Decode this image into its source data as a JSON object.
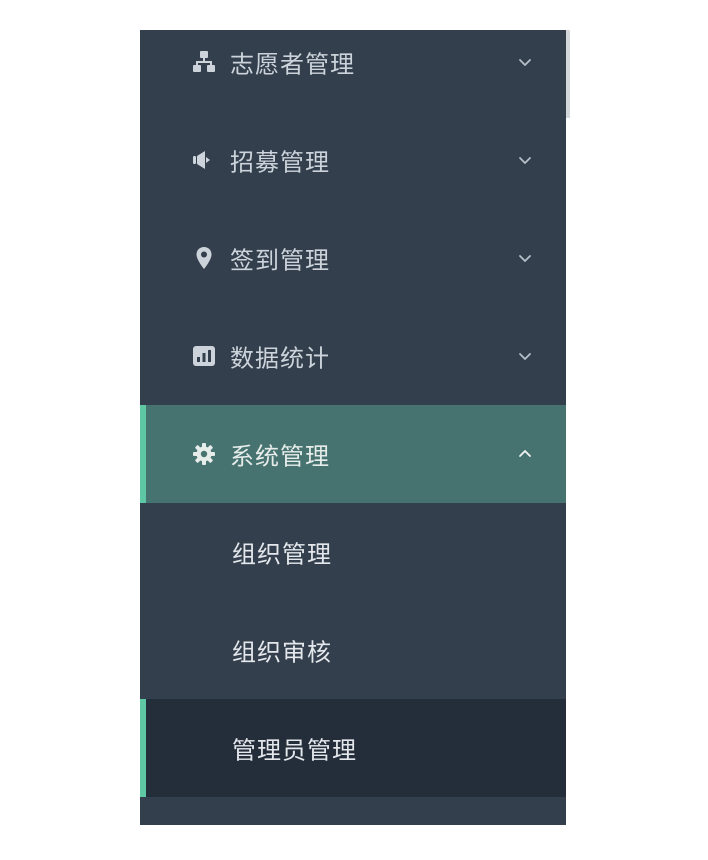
{
  "colors": {
    "sidebar_bg": "#333f4d",
    "expanded_bg": "#46726f",
    "active_sub_bg": "#242d3a",
    "accent": "#5ec7a4",
    "text": "#ccd3da"
  },
  "menu": {
    "items": [
      {
        "label": "志愿者管理",
        "icon": "sitemap-icon",
        "state": "collapsed"
      },
      {
        "label": "招募管理",
        "icon": "bullhorn-icon",
        "state": "collapsed"
      },
      {
        "label": "签到管理",
        "icon": "map-marker-icon",
        "state": "collapsed"
      },
      {
        "label": "数据统计",
        "icon": "bar-chart-icon",
        "state": "collapsed"
      },
      {
        "label": "系统管理",
        "icon": "gear-icon",
        "state": "expanded"
      }
    ],
    "sub_items": [
      {
        "label": "组织管理",
        "active": false
      },
      {
        "label": "组织审核",
        "active": false
      },
      {
        "label": "管理员管理",
        "active": true
      }
    ]
  }
}
